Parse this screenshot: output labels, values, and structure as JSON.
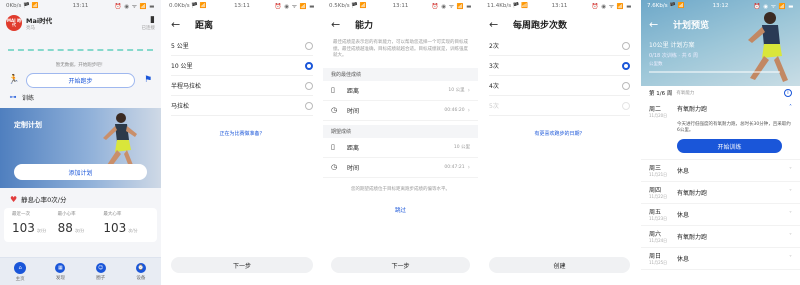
{
  "screen1": {
    "status_left": "0Kb/s 🏴 📶",
    "status_time": "13:11",
    "status_right": "⏰ ◉ ᯤ 📶 ▬",
    "logo_text": "MAI 時代",
    "app_name": "Mai时代",
    "app_sub": "亮马",
    "hdr_right": "已连接",
    "hint": "暂无数据，开始跑步吧！",
    "start_btn": "开始跑步",
    "train_label": "训练",
    "card_title": "定制计划",
    "card_btn": "添加计划",
    "hr_title": "静息心率0次/分",
    "stats": [
      {
        "label": "最近一次",
        "value": "103",
        "unit": "次/分"
      },
      {
        "label": "最小心率",
        "value": "88",
        "unit": "次/分"
      },
      {
        "label": "最大心率",
        "value": "103",
        "unit": "次/分"
      }
    ],
    "tabs": [
      "主页",
      "发现",
      "圈子",
      "设备"
    ]
  },
  "screen2": {
    "status_left": "0.0Kb/s 🏴 📶",
    "status_time": "13:11",
    "status_right": "⏰ ◉ ᯤ 📶 ▬",
    "title": "距离",
    "options": [
      {
        "label": "5 公里",
        "selected": false
      },
      {
        "label": "10 公里",
        "selected": true
      },
      {
        "label": "半程马拉松",
        "selected": false
      },
      {
        "label": "马拉松",
        "selected": false
      }
    ],
    "link": "正在为比赛做准备？",
    "next_btn": "下一步"
  },
  "screen3": {
    "status_left": "0.5Kb/s 🏴 📶",
    "status_time": "13:11",
    "status_right": "⏰ ◉ ᯤ 📶 ▬",
    "title": "能力",
    "desc": "最佳成绩是表示您的有氧能力，可以帮助您选择一个可实现的目标成绩。最佳成绩越准确，目标成绩就越合适。目标成绩就是，训练强度就大。",
    "best_head": "我的最佳成绩",
    "best_rows": [
      {
        "icon": "ruler-icon",
        "label": "距离",
        "value": "10 公里"
      },
      {
        "icon": "clock-icon",
        "label": "时间",
        "value": "00:46:20"
      }
    ],
    "target_head": "期望成绩",
    "target_rows": [
      {
        "icon": "ruler-icon",
        "label": "距离",
        "value": "10 公里"
      },
      {
        "icon": "clock-icon",
        "label": "时间",
        "value": "00:47:21"
      }
    ],
    "note": "您的期望成绩位于目标距离跑步成绩的偏等水平。",
    "skip": "跳过",
    "next_btn": "下一步"
  },
  "screen4": {
    "status_left": "11.4Kb/s 🏴 📶",
    "status_time": "13:11",
    "status_right": "⏰ ◉ ᯤ 📶 ▬",
    "title": "每周跑步次数",
    "options": [
      {
        "label": "2次",
        "selected": false,
        "disabled": false
      },
      {
        "label": "3次",
        "selected": true,
        "disabled": false
      },
      {
        "label": "4次",
        "selected": false,
        "disabled": false
      },
      {
        "label": "5次",
        "selected": false,
        "disabled": true
      }
    ],
    "link": "有更喜欢跑步的日期？",
    "create_btn": "创建"
  },
  "screen5": {
    "status_left": "7.6Kb/s 🏴 📶",
    "status_time": "13:12",
    "status_right": "⏰ ◉ ᯤ 📶 ▬",
    "title": "计划预览",
    "kicker": "10公里 计划方案",
    "kicker2": "0/18 次训练 · 共 6 周",
    "kicker3": "公里数",
    "week_title": "第 1/6 周",
    "week_sub": "有氧能力",
    "open_day": {
      "name": "周二",
      "date": "11月20日",
      "activity": "有氧耐力跑",
      "detail": "今天进行低强度的有氧耐力跑，总时长30分钟，且采取约6公里。",
      "button": "开始训练"
    },
    "days": [
      {
        "name": "周三",
        "date": "11月21日",
        "activity": "休息"
      },
      {
        "name": "周四",
        "date": "11月22日",
        "activity": "有氧耐力跑"
      },
      {
        "name": "周五",
        "date": "11月23日",
        "activity": "休息"
      },
      {
        "name": "周六",
        "date": "11月24日",
        "activity": "有氧耐力跑"
      },
      {
        "name": "周日",
        "date": "11月25日",
        "activity": "休息"
      }
    ]
  }
}
